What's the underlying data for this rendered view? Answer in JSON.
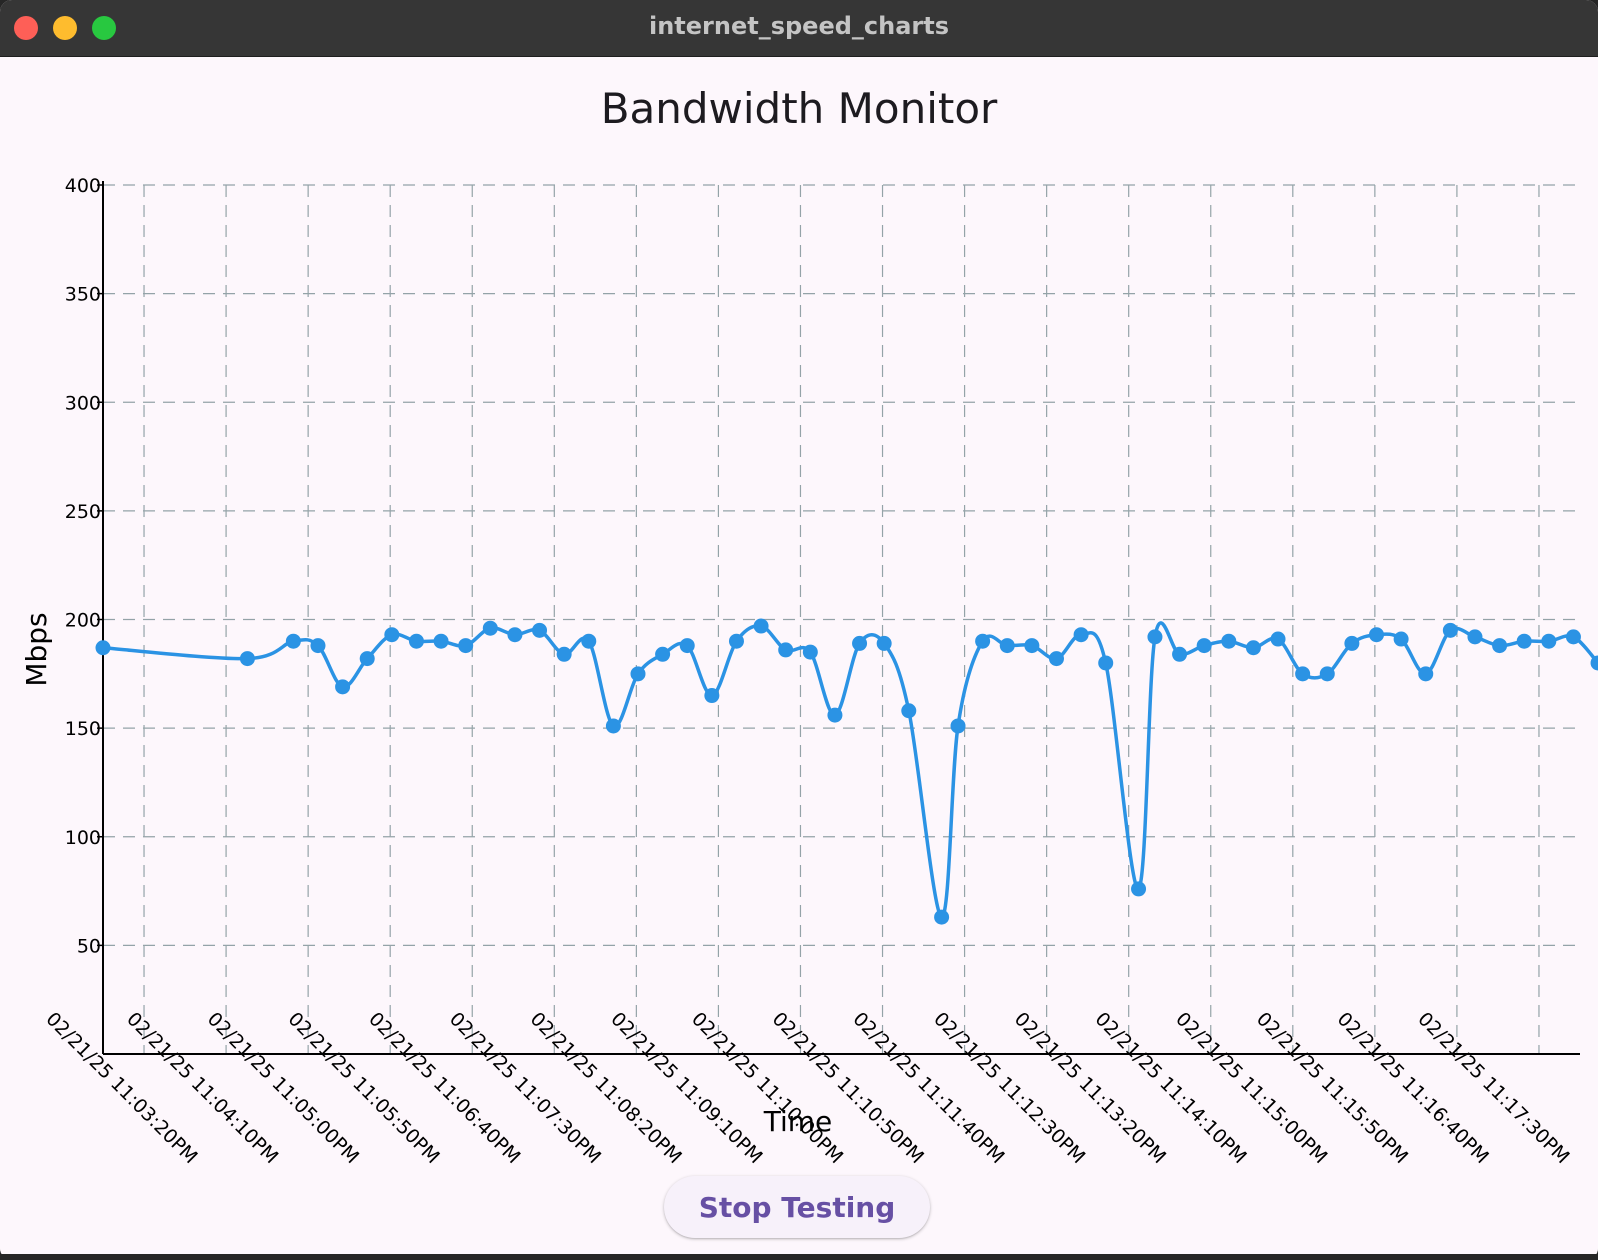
{
  "window": {
    "title": "internet_speed_charts"
  },
  "page": {
    "heading": "Bandwidth Monitor"
  },
  "controls": {
    "stop_label": "Stop Testing"
  },
  "colors": {
    "line": "#2b93e4",
    "grid": "#94a3a8",
    "axis": "#000000",
    "accent": "#6750a4"
  },
  "chart_data": {
    "type": "line",
    "title": "",
    "xlabel": "Time",
    "ylabel": "Mbps",
    "ylim": [
      0,
      400
    ],
    "yticks": [
      50,
      100,
      150,
      200,
      250,
      300,
      350,
      400
    ],
    "x_axis_start": "02/21/25 11:03:20PM",
    "x_axis_end": "02/21/25 11:18:20PM",
    "x_tick_step_seconds": 50,
    "x_tick_labels": [
      "02/21/25 11:03:20PM",
      "02/21/25 11:04:10PM",
      "02/21/25 11:05:00PM",
      "02/21/25 11:05:50PM",
      "02/21/25 11:06:40PM",
      "02/21/25 11:07:30PM",
      "02/21/25 11:08:20PM",
      "02/21/25 11:09:10PM",
      "02/21/25 11:10:00PM",
      "02/21/25 11:10:50PM",
      "02/21/25 11:11:40PM",
      "02/21/25 11:12:30PM",
      "02/21/25 11:13:20PM",
      "02/21/25 11:14:10PM",
      "02/21/25 11:15:00PM",
      "02/21/25 11:15:50PM",
      "02/21/25 11:16:40PM",
      "02/21/25 11:17:30PM"
    ],
    "grid": true,
    "series": [
      {
        "smooth": true,
        "points": [
          {
            "x": "02/21/25 11:03:20PM",
            "y": 187
          },
          {
            "x": "02/21/25 11:04:48PM",
            "y": 182
          },
          {
            "x": "02/21/25 11:05:16PM",
            "y": 190
          },
          {
            "x": "02/21/25 11:05:31PM",
            "y": 188
          },
          {
            "x": "02/21/25 11:05:46PM",
            "y": 169
          },
          {
            "x": "02/21/25 11:06:01PM",
            "y": 182
          },
          {
            "x": "02/21/25 11:06:16PM",
            "y": 193
          },
          {
            "x": "02/21/25 11:06:31PM",
            "y": 190
          },
          {
            "x": "02/21/25 11:06:46PM",
            "y": 190
          },
          {
            "x": "02/21/25 11:07:01PM",
            "y": 188
          },
          {
            "x": "02/21/25 11:07:16PM",
            "y": 196
          },
          {
            "x": "02/21/25 11:07:31PM",
            "y": 193
          },
          {
            "x": "02/21/25 11:07:46PM",
            "y": 195
          },
          {
            "x": "02/21/25 11:08:01PM",
            "y": 184
          },
          {
            "x": "02/21/25 11:08:16PM",
            "y": 190
          },
          {
            "x": "02/21/25 11:08:31PM",
            "y": 151
          },
          {
            "x": "02/21/25 11:08:46PM",
            "y": 175
          },
          {
            "x": "02/21/25 11:09:01PM",
            "y": 184
          },
          {
            "x": "02/21/25 11:09:16PM",
            "y": 188
          },
          {
            "x": "02/21/25 11:09:31PM",
            "y": 165
          },
          {
            "x": "02/21/25 11:09:46PM",
            "y": 190
          },
          {
            "x": "02/21/25 11:10:01PM",
            "y": 197
          },
          {
            "x": "02/21/25 11:10:16PM",
            "y": 186
          },
          {
            "x": "02/21/25 11:10:31PM",
            "y": 185
          },
          {
            "x": "02/21/25 11:10:46PM",
            "y": 156
          },
          {
            "x": "02/21/25 11:11:01PM",
            "y": 189
          },
          {
            "x": "02/21/25 11:11:16PM",
            "y": 189
          },
          {
            "x": "02/21/25 11:11:31PM",
            "y": 158
          },
          {
            "x": "02/21/25 11:11:51PM",
            "y": 63
          },
          {
            "x": "02/21/25 11:12:01PM",
            "y": 151
          },
          {
            "x": "02/21/25 11:12:16PM",
            "y": 190
          },
          {
            "x": "02/21/25 11:12:31PM",
            "y": 188
          },
          {
            "x": "02/21/25 11:12:46PM",
            "y": 188
          },
          {
            "x": "02/21/25 11:13:01PM",
            "y": 182
          },
          {
            "x": "02/21/25 11:13:16PM",
            "y": 193
          },
          {
            "x": "02/21/25 11:13:31PM",
            "y": 180
          },
          {
            "x": "02/21/25 11:13:51PM",
            "y": 76
          },
          {
            "x": "02/21/25 11:14:01PM",
            "y": 192
          },
          {
            "x": "02/21/25 11:14:16PM",
            "y": 184
          },
          {
            "x": "02/21/25 11:14:31PM",
            "y": 188
          },
          {
            "x": "02/21/25 11:14:46PM",
            "y": 190
          },
          {
            "x": "02/21/25 11:15:01PM",
            "y": 187
          },
          {
            "x": "02/21/25 11:15:16PM",
            "y": 191
          },
          {
            "x": "02/21/25 11:15:31PM",
            "y": 175
          },
          {
            "x": "02/21/25 11:15:46PM",
            "y": 175
          },
          {
            "x": "02/21/25 11:16:01PM",
            "y": 189
          },
          {
            "x": "02/21/25 11:16:16PM",
            "y": 193
          },
          {
            "x": "02/21/25 11:16:31PM",
            "y": 191
          },
          {
            "x": "02/21/25 11:16:46PM",
            "y": 175
          },
          {
            "x": "02/21/25 11:17:01PM",
            "y": 195
          },
          {
            "x": "02/21/25 11:17:16PM",
            "y": 192
          },
          {
            "x": "02/21/25 11:17:31PM",
            "y": 188
          },
          {
            "x": "02/21/25 11:17:46PM",
            "y": 190
          },
          {
            "x": "02/21/25 11:18:01PM",
            "y": 190
          },
          {
            "x": "02/21/25 11:18:16PM",
            "y": 192
          },
          {
            "x": "02/21/25 11:18:31PM",
            "y": 180
          }
        ]
      }
    ]
  }
}
